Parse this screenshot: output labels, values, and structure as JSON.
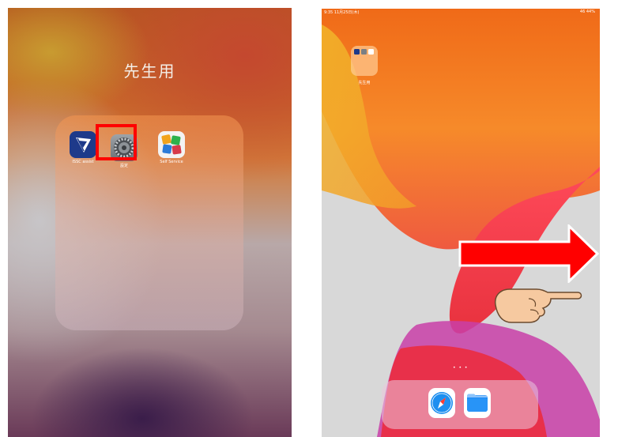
{
  "left": {
    "folder_title": "先生用",
    "apps": [
      {
        "name": "ISSC-assist",
        "label": "ISSC assist"
      },
      {
        "name": "settings",
        "label": "設定"
      },
      {
        "name": "self-service",
        "label": "Self Service"
      }
    ]
  },
  "right": {
    "status_left": "9:35 11月25日(木)",
    "status_right": "46 44%",
    "folder_label": "先生用",
    "page_dots": "• • •"
  },
  "colors": {
    "highlight": "#ff0000",
    "arrow_fill": "#ff0000",
    "issc_blue": "#1e3a8a",
    "safari_blue": "#1d8ff0",
    "files_blue": "#1e8bf5"
  },
  "icons": [
    "issc-assist-icon",
    "settings-gear-icon",
    "self-service-icon",
    "safari-icon",
    "files-icon",
    "pointing-hand-icon",
    "swipe-right-arrow-icon"
  ]
}
